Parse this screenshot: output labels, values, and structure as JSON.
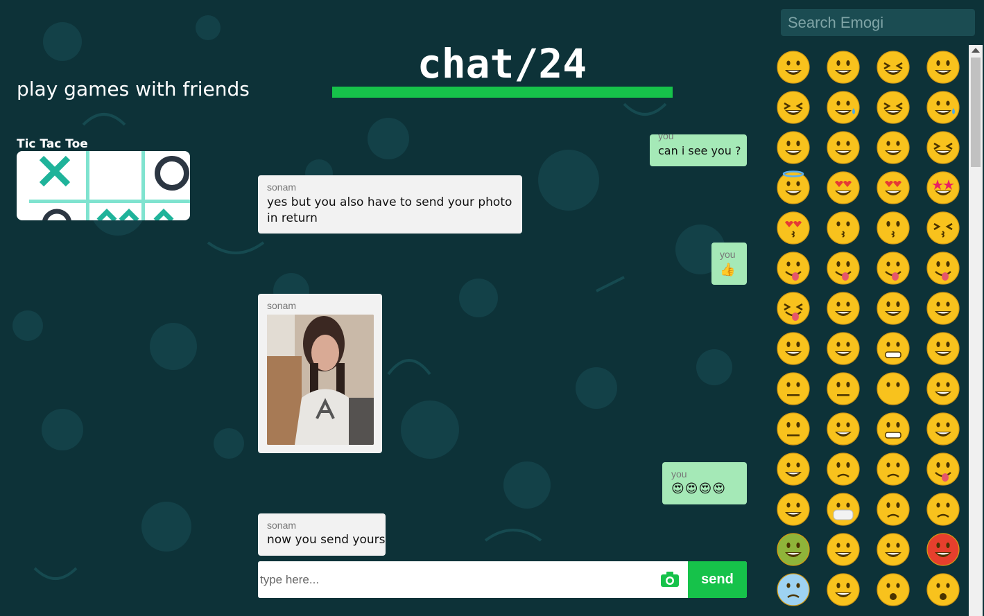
{
  "header": {
    "title": "chat/24"
  },
  "left": {
    "title": "play games with friends",
    "games": [
      {
        "label": "Tic Tac Toe"
      }
    ]
  },
  "messages": [
    {
      "sender": "you",
      "text": "can i see you ?"
    },
    {
      "sender": "sonam",
      "text": "yes but you also have to send your photo in return"
    },
    {
      "sender": "you",
      "text": "👍"
    },
    {
      "sender": "sonam",
      "text": ""
    },
    {
      "sender": "you",
      "text": "😍😍😍😍"
    },
    {
      "sender": "sonam",
      "text": "now you send yours"
    }
  ],
  "composer": {
    "placeholder": "type here...",
    "send_label": "send",
    "camera_icon": "camera-icon"
  },
  "emoji_panel": {
    "search_placeholder": "Search Emogi"
  },
  "colors": {
    "background": "#0d3238",
    "accent": "#16c24a",
    "you_bubble": "#a5e9b7",
    "them_bubble": "#f2f2f2"
  }
}
